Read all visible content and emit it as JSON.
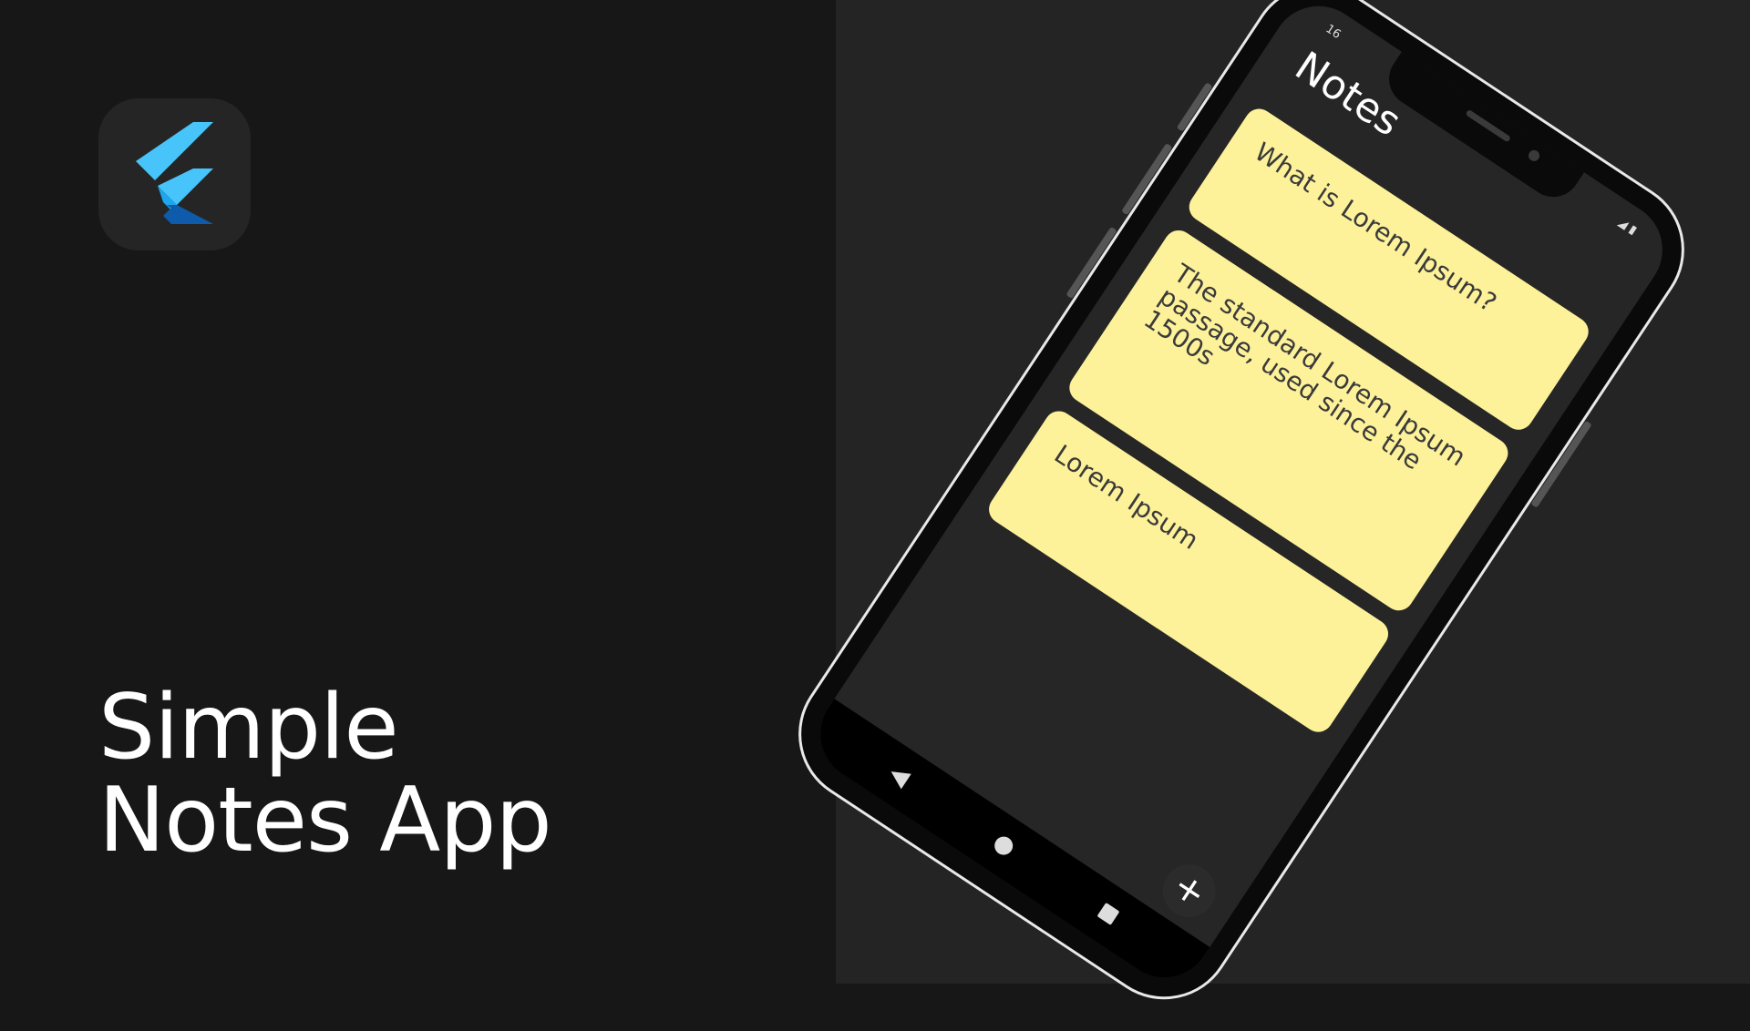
{
  "hero": {
    "title_line1": "Simple",
    "title_line2": "Notes App"
  },
  "logo": {
    "icon": "flutter-logo",
    "colors": {
      "light_blue": "#47c5fb",
      "mid_blue": "#1ca6ee",
      "dark_blue": "#0d5baa"
    }
  },
  "phone": {
    "status_time": "16",
    "screen_title": "Notes",
    "notes": [
      {
        "text": "What is Lorem Ipsum?"
      },
      {
        "text": "The standard Lorem Ipsum passage, used since the 1500s"
      },
      {
        "text": "Lorem Ipsum"
      }
    ],
    "fab_label": "+",
    "nav": {
      "back_icon": "back-triangle-icon",
      "home_icon": "home-circle-icon",
      "recent_icon": "recents-square-icon"
    },
    "note_color": "#fdf29a"
  },
  "theme": {
    "left_bg": "#171717",
    "right_bg": "#242424",
    "text": "#ffffff"
  }
}
